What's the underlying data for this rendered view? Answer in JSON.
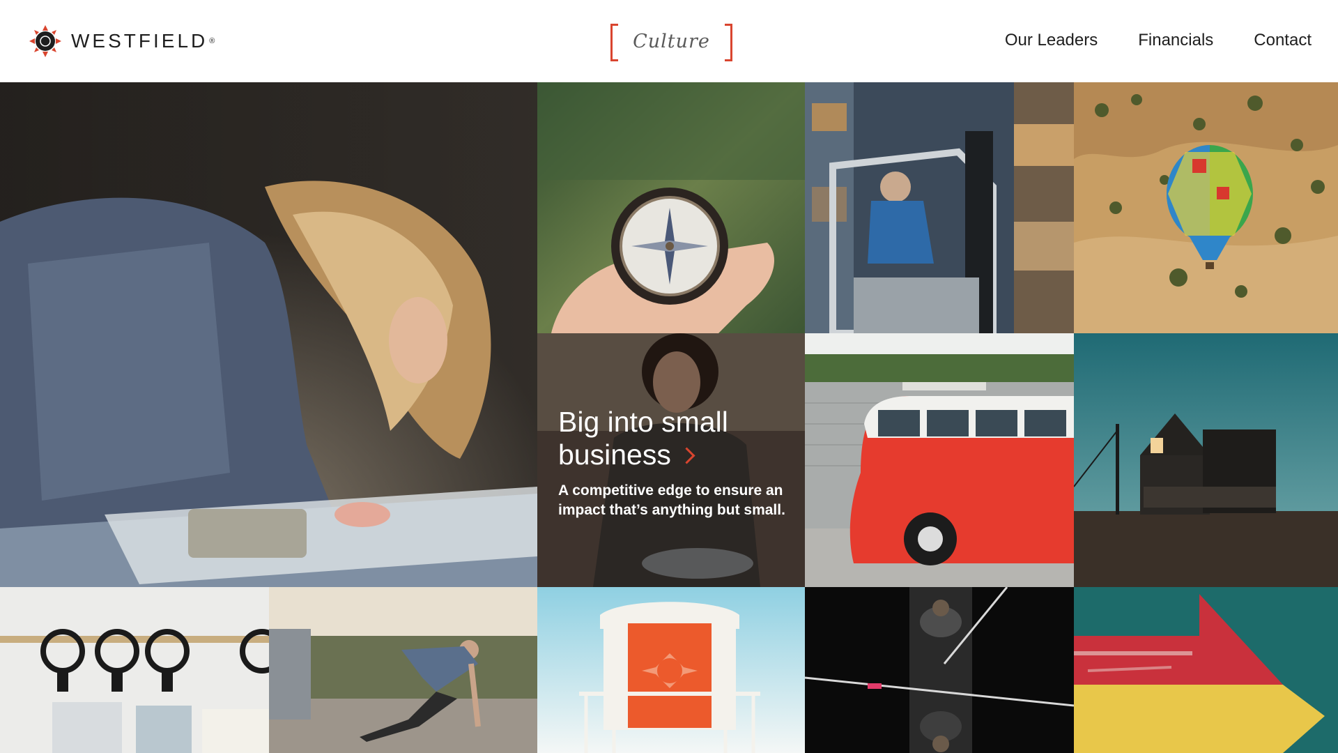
{
  "brand": {
    "name": "WESTFIELD",
    "registered_mark": "®",
    "accent_color": "#d9452f"
  },
  "header": {
    "section_label": "Culture",
    "nav": [
      {
        "label": "Our Leaders"
      },
      {
        "label": "Financials"
      },
      {
        "label": "Contact"
      }
    ]
  },
  "feature": {
    "headline_line1": "Big into small",
    "headline_line2": "business",
    "subtext": "A competitive edge to ensure an impact that’s anything but small."
  },
  "tiles": [
    {
      "subject": "woman-studying-map-photo"
    },
    {
      "subject": "compass-in-hand-photo"
    },
    {
      "subject": "forklift-warehouse-photo"
    },
    {
      "subject": "hot-air-balloon-photo"
    },
    {
      "subject": "red-vw-bus-photo"
    },
    {
      "subject": "house-at-dusk-photo"
    },
    {
      "subject": "curtain-rings-photo"
    },
    {
      "subject": "breakdancer-photo"
    },
    {
      "subject": "lifeguard-tower-photo"
    },
    {
      "subject": "rowers-overhead-photo"
    },
    {
      "subject": "painted-arrow-wall-photo"
    }
  ]
}
